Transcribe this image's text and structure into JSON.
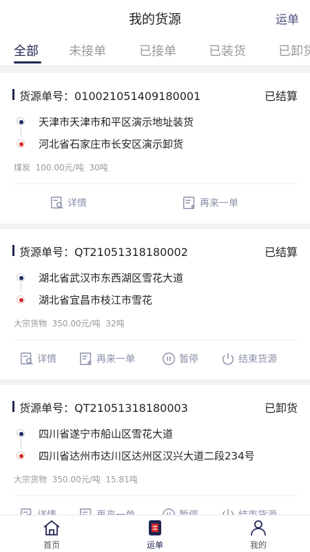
{
  "header": {
    "title": "我的货源",
    "right_action": "运单"
  },
  "tabs": [
    {
      "label": "全部",
      "active": true
    },
    {
      "label": "未接单"
    },
    {
      "label": "已接单"
    },
    {
      "label": "已装货"
    },
    {
      "label": "已卸货"
    }
  ],
  "cards": [
    {
      "no_label": "货源单号：",
      "no": "01002105140918000 1",
      "status": "已结算",
      "from": "天津市天津市和平区演示地址装货",
      "to": "河北省石家庄市长安区演示卸货",
      "cargo": "煤炭",
      "price": "100.00元/吨",
      "weight": "30吨",
      "actions": [
        "详情",
        "再来一单"
      ]
    },
    {
      "no_label": "货源单号：",
      "no": "QT21051318180002",
      "status": "已结算",
      "from": "湖北省武汉市东西湖区雪花大道",
      "to": "湖北省宜昌市枝江市雪花",
      "cargo": "大宗货物",
      "price": "350.00元/吨",
      "weight": "32吨",
      "actions": [
        "详情",
        "再来一单",
        "暂停",
        "结束货源"
      ]
    },
    {
      "no_label": "货源单号：",
      "no": "QT21051318180003",
      "status": "已卸货",
      "from": "四川省遂宁市船山区雪花大道",
      "to": "四川省达州市达川区达州区汉兴大道二段234号",
      "cargo": "大宗货物",
      "price": "350.00元/吨",
      "weight": "15.81吨",
      "actions": [
        "详情",
        "再来一单",
        "暂停",
        "结束货源"
      ]
    }
  ],
  "bottom_nav": [
    {
      "label": "首页",
      "icon": "home-icon"
    },
    {
      "label": "运单",
      "icon": "waybill-icon",
      "active": true
    },
    {
      "label": "我的",
      "icon": "profile-icon"
    }
  ],
  "colors": {
    "accent": "#1f2550",
    "from_dot": "#1f2a66",
    "to_dot": "#d62b2b",
    "action": "#8a90a8"
  }
}
